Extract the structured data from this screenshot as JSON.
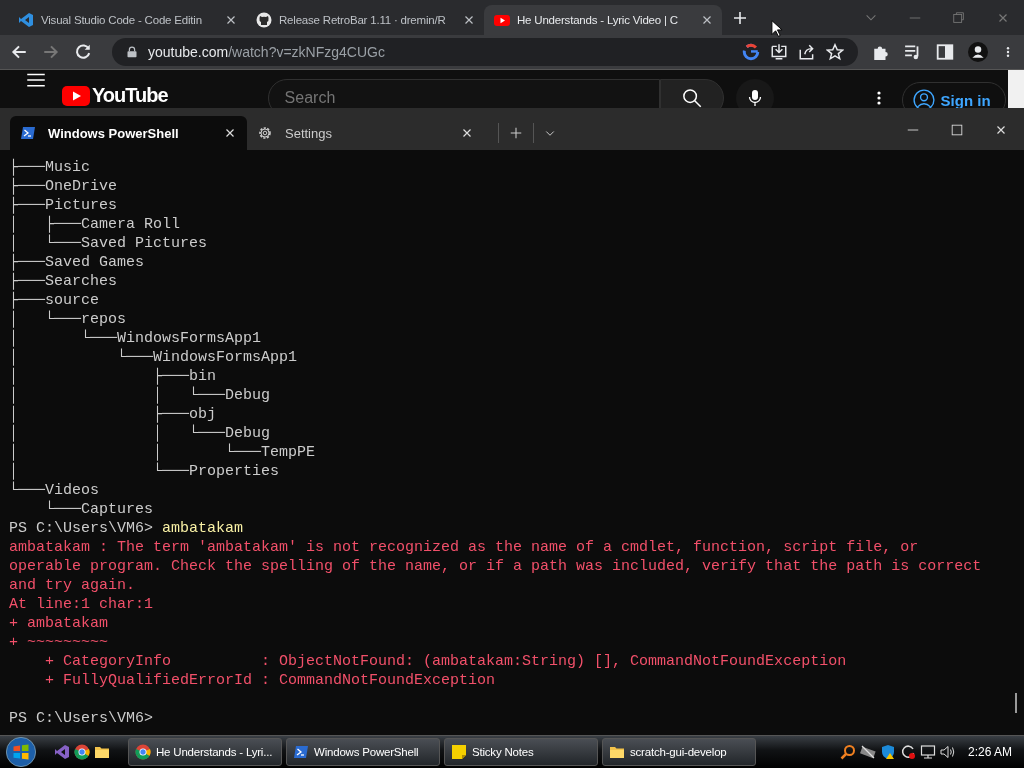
{
  "browser": {
    "tabs": [
      {
        "kind": "vscode",
        "title": "Visual Studio Code - Code Editin",
        "selected": false
      },
      {
        "kind": "github",
        "title": "Release RetroBar 1.11 · dremin/R",
        "selected": false
      },
      {
        "kind": "youtube",
        "title": "He Understands - Lyric Video | C",
        "selected": true
      }
    ],
    "url": {
      "host": "youtube.com",
      "path": "/watch?v=zkNFzg4CUGc"
    },
    "page": {
      "logo": "YouTube",
      "search_placeholder": "Search",
      "sign_in": "Sign in"
    }
  },
  "terminal": {
    "tabs": [
      {
        "kind": "powershell",
        "title": "Windows PowerShell",
        "selected": true
      },
      {
        "kind": "gear",
        "title": "Settings",
        "selected": false
      }
    ],
    "lines": [
      {
        "kind": "output",
        "text": "├───Music"
      },
      {
        "kind": "output",
        "text": "├───OneDrive"
      },
      {
        "kind": "output",
        "text": "├───Pictures"
      },
      {
        "kind": "output",
        "text": "│   ├───Camera Roll"
      },
      {
        "kind": "output",
        "text": "│   └───Saved Pictures"
      },
      {
        "kind": "output",
        "text": "├───Saved Games"
      },
      {
        "kind": "output",
        "text": "├───Searches"
      },
      {
        "kind": "output",
        "text": "├───source"
      },
      {
        "kind": "output",
        "text": "│   └───repos"
      },
      {
        "kind": "output",
        "text": "│       └───WindowsFormsApp1"
      },
      {
        "kind": "output",
        "text": "│           └───WindowsFormsApp1"
      },
      {
        "kind": "output",
        "text": "│               ├───bin"
      },
      {
        "kind": "output",
        "text": "│               │   └───Debug"
      },
      {
        "kind": "output",
        "text": "│               ├───obj"
      },
      {
        "kind": "output",
        "text": "│               │   └───Debug"
      },
      {
        "kind": "output",
        "text": "│               │       └───TempPE"
      },
      {
        "kind": "output",
        "text": "│               └───Properties"
      },
      {
        "kind": "output",
        "text": "└───Videos"
      },
      {
        "kind": "output",
        "text": "    └───Captures"
      },
      {
        "kind": "prompt",
        "prompt": "PS C:\\Users\\VM6>",
        "command": "ambatakam"
      },
      {
        "kind": "error",
        "text": "ambatakam : The term 'ambatakam' is not recognized as the name of a cmdlet, function, script file, or"
      },
      {
        "kind": "error",
        "text": "operable program. Check the spelling of the name, or if a path was included, verify that the path is correct"
      },
      {
        "kind": "error",
        "text": "and try again."
      },
      {
        "kind": "error",
        "text": "At line:1 char:1"
      },
      {
        "kind": "error",
        "text": "+ ambatakam"
      },
      {
        "kind": "error",
        "text": "+ ~~~~~~~~~"
      },
      {
        "kind": "error",
        "text": "    + CategoryInfo          : ObjectNotFound: (ambatakam:String) [], CommandNotFoundException"
      },
      {
        "kind": "error",
        "text": "    + FullyQualifiedErrorId : CommandNotFoundException"
      },
      {
        "kind": "blank"
      },
      {
        "kind": "prompt",
        "prompt": "PS C:\\Users\\VM6>"
      }
    ]
  },
  "taskbar": {
    "buttons": [
      {
        "kind": "chrome",
        "label": "He Understands - Lyri..."
      },
      {
        "kind": "powershell",
        "label": "Windows PowerShell"
      },
      {
        "kind": "note",
        "label": "Sticky Notes"
      },
      {
        "kind": "folder",
        "label": "scratch-gui-develop"
      }
    ],
    "clock": "2:26 AM"
  }
}
